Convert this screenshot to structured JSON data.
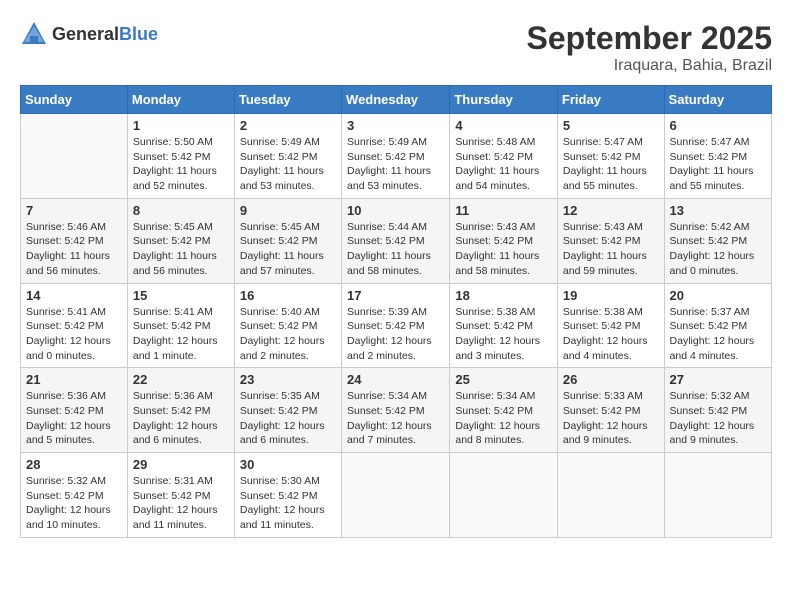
{
  "header": {
    "logo_general": "General",
    "logo_blue": "Blue",
    "month": "September 2025",
    "location": "Iraquara, Bahia, Brazil"
  },
  "weekdays": [
    "Sunday",
    "Monday",
    "Tuesday",
    "Wednesday",
    "Thursday",
    "Friday",
    "Saturday"
  ],
  "weeks": [
    [
      {
        "day": "",
        "sunrise": "",
        "sunset": "",
        "daylight": ""
      },
      {
        "day": "1",
        "sunrise": "Sunrise: 5:50 AM",
        "sunset": "Sunset: 5:42 PM",
        "daylight": "Daylight: 11 hours and 52 minutes."
      },
      {
        "day": "2",
        "sunrise": "Sunrise: 5:49 AM",
        "sunset": "Sunset: 5:42 PM",
        "daylight": "Daylight: 11 hours and 53 minutes."
      },
      {
        "day": "3",
        "sunrise": "Sunrise: 5:49 AM",
        "sunset": "Sunset: 5:42 PM",
        "daylight": "Daylight: 11 hours and 53 minutes."
      },
      {
        "day": "4",
        "sunrise": "Sunrise: 5:48 AM",
        "sunset": "Sunset: 5:42 PM",
        "daylight": "Daylight: 11 hours and 54 minutes."
      },
      {
        "day": "5",
        "sunrise": "Sunrise: 5:47 AM",
        "sunset": "Sunset: 5:42 PM",
        "daylight": "Daylight: 11 hours and 55 minutes."
      },
      {
        "day": "6",
        "sunrise": "Sunrise: 5:47 AM",
        "sunset": "Sunset: 5:42 PM",
        "daylight": "Daylight: 11 hours and 55 minutes."
      }
    ],
    [
      {
        "day": "7",
        "sunrise": "Sunrise: 5:46 AM",
        "sunset": "Sunset: 5:42 PM",
        "daylight": "Daylight: 11 hours and 56 minutes."
      },
      {
        "day": "8",
        "sunrise": "Sunrise: 5:45 AM",
        "sunset": "Sunset: 5:42 PM",
        "daylight": "Daylight: 11 hours and 56 minutes."
      },
      {
        "day": "9",
        "sunrise": "Sunrise: 5:45 AM",
        "sunset": "Sunset: 5:42 PM",
        "daylight": "Daylight: 11 hours and 57 minutes."
      },
      {
        "day": "10",
        "sunrise": "Sunrise: 5:44 AM",
        "sunset": "Sunset: 5:42 PM",
        "daylight": "Daylight: 11 hours and 58 minutes."
      },
      {
        "day": "11",
        "sunrise": "Sunrise: 5:43 AM",
        "sunset": "Sunset: 5:42 PM",
        "daylight": "Daylight: 11 hours and 58 minutes."
      },
      {
        "day": "12",
        "sunrise": "Sunrise: 5:43 AM",
        "sunset": "Sunset: 5:42 PM",
        "daylight": "Daylight: 11 hours and 59 minutes."
      },
      {
        "day": "13",
        "sunrise": "Sunrise: 5:42 AM",
        "sunset": "Sunset: 5:42 PM",
        "daylight": "Daylight: 12 hours and 0 minutes."
      }
    ],
    [
      {
        "day": "14",
        "sunrise": "Sunrise: 5:41 AM",
        "sunset": "Sunset: 5:42 PM",
        "daylight": "Daylight: 12 hours and 0 minutes."
      },
      {
        "day": "15",
        "sunrise": "Sunrise: 5:41 AM",
        "sunset": "Sunset: 5:42 PM",
        "daylight": "Daylight: 12 hours and 1 minute."
      },
      {
        "day": "16",
        "sunrise": "Sunrise: 5:40 AM",
        "sunset": "Sunset: 5:42 PM",
        "daylight": "Daylight: 12 hours and 2 minutes."
      },
      {
        "day": "17",
        "sunrise": "Sunrise: 5:39 AM",
        "sunset": "Sunset: 5:42 PM",
        "daylight": "Daylight: 12 hours and 2 minutes."
      },
      {
        "day": "18",
        "sunrise": "Sunrise: 5:38 AM",
        "sunset": "Sunset: 5:42 PM",
        "daylight": "Daylight: 12 hours and 3 minutes."
      },
      {
        "day": "19",
        "sunrise": "Sunrise: 5:38 AM",
        "sunset": "Sunset: 5:42 PM",
        "daylight": "Daylight: 12 hours and 4 minutes."
      },
      {
        "day": "20",
        "sunrise": "Sunrise: 5:37 AM",
        "sunset": "Sunset: 5:42 PM",
        "daylight": "Daylight: 12 hours and 4 minutes."
      }
    ],
    [
      {
        "day": "21",
        "sunrise": "Sunrise: 5:36 AM",
        "sunset": "Sunset: 5:42 PM",
        "daylight": "Daylight: 12 hours and 5 minutes."
      },
      {
        "day": "22",
        "sunrise": "Sunrise: 5:36 AM",
        "sunset": "Sunset: 5:42 PM",
        "daylight": "Daylight: 12 hours and 6 minutes."
      },
      {
        "day": "23",
        "sunrise": "Sunrise: 5:35 AM",
        "sunset": "Sunset: 5:42 PM",
        "daylight": "Daylight: 12 hours and 6 minutes."
      },
      {
        "day": "24",
        "sunrise": "Sunrise: 5:34 AM",
        "sunset": "Sunset: 5:42 PM",
        "daylight": "Daylight: 12 hours and 7 minutes."
      },
      {
        "day": "25",
        "sunrise": "Sunrise: 5:34 AM",
        "sunset": "Sunset: 5:42 PM",
        "daylight": "Daylight: 12 hours and 8 minutes."
      },
      {
        "day": "26",
        "sunrise": "Sunrise: 5:33 AM",
        "sunset": "Sunset: 5:42 PM",
        "daylight": "Daylight: 12 hours and 9 minutes."
      },
      {
        "day": "27",
        "sunrise": "Sunrise: 5:32 AM",
        "sunset": "Sunset: 5:42 PM",
        "daylight": "Daylight: 12 hours and 9 minutes."
      }
    ],
    [
      {
        "day": "28",
        "sunrise": "Sunrise: 5:32 AM",
        "sunset": "Sunset: 5:42 PM",
        "daylight": "Daylight: 12 hours and 10 minutes."
      },
      {
        "day": "29",
        "sunrise": "Sunrise: 5:31 AM",
        "sunset": "Sunset: 5:42 PM",
        "daylight": "Daylight: 12 hours and 11 minutes."
      },
      {
        "day": "30",
        "sunrise": "Sunrise: 5:30 AM",
        "sunset": "Sunset: 5:42 PM",
        "daylight": "Daylight: 12 hours and 11 minutes."
      },
      {
        "day": "",
        "sunrise": "",
        "sunset": "",
        "daylight": ""
      },
      {
        "day": "",
        "sunrise": "",
        "sunset": "",
        "daylight": ""
      },
      {
        "day": "",
        "sunrise": "",
        "sunset": "",
        "daylight": ""
      },
      {
        "day": "",
        "sunrise": "",
        "sunset": "",
        "daylight": ""
      }
    ]
  ]
}
